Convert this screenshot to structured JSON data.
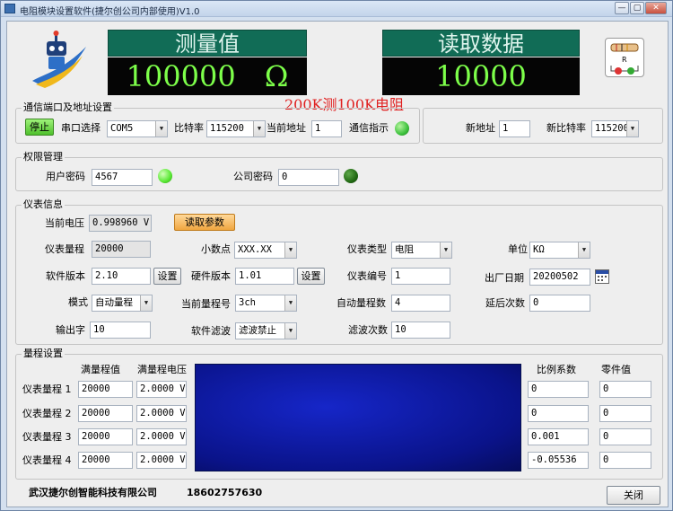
{
  "window": {
    "title": "电阻模块设置软件(捷尔创公司内部使用)V1.0",
    "controls": [
      "—",
      "▢",
      "✕"
    ]
  },
  "display": {
    "measured_title": "测量值",
    "measured_value": "100000",
    "measured_unit": "Ω",
    "read_title": "读取数据",
    "read_value": "10000",
    "annotation": "200K测100K电阻",
    "annotation_color": "#e02020",
    "screen_bg": "#050505",
    "digit_color": "#7dff4a"
  },
  "comm": {
    "group_title": "通信端口及地址设置",
    "stop_button": "停止",
    "port_label": "串口选择",
    "port_value": "COM5",
    "baud_label": "比特率",
    "baud_value": "115200",
    "addr_label": "当前地址",
    "addr_value": "1",
    "indicator_label": "通信指示",
    "indicator_color": "#3cc13c",
    "new_addr_label": "新地址",
    "new_addr_value": "1",
    "new_baud_label": "新比特率",
    "new_baud_value": "115200"
  },
  "auth": {
    "group_title": "权限管理",
    "user_pwd_label": "用户密码",
    "user_pwd_value": "4567",
    "user_led_color": "#57e832",
    "company_pwd_label": "公司密码",
    "company_pwd_value": "0",
    "company_led_color": "#226a14"
  },
  "instrument": {
    "group_title": "仪表信息",
    "voltage_label": "当前电压",
    "voltage_value": "0.998960 V",
    "read_params_button": "读取参数",
    "range_label": "仪表量程",
    "range_value": "20000",
    "decimal_label": "小数点",
    "decimal_value": "XXX.XX",
    "type_label": "仪表类型",
    "type_value": "电阻",
    "unit_label": "单位",
    "unit_value": "KΩ",
    "sw_ver_label": "软件版本",
    "sw_ver_value": "2.10",
    "set_button": "设置",
    "hw_ver_label": "硬件版本",
    "hw_ver_value": "1.01",
    "serial_label": "仪表编号",
    "serial_value": "1",
    "date_label": "出厂日期",
    "date_value": "20200502",
    "mode_label": "模式",
    "mode_value": "自动量程",
    "cur_range_label": "当前量程号",
    "cur_range_value": "3ch",
    "auto_count_label": "自动量程数",
    "auto_count_value": "4",
    "delay_label": "延后次数",
    "delay_value": "0",
    "output_label": "输出字",
    "output_value": "10",
    "filter_label": "软件滤波",
    "filter_value": "滤波禁止",
    "filter_count_label": "滤波次数",
    "filter_count_value": "10"
  },
  "ranges": {
    "group_title": "量程设置",
    "headers": {
      "full_value": "满量程值",
      "full_voltage": "满量程电压",
      "ratio": "比例系数",
      "zero": "零件值"
    },
    "rows": [
      {
        "label": "仪表量程 1",
        "full_value": "20000",
        "full_voltage": "2.0000 V",
        "ratio": "0",
        "zero": "0"
      },
      {
        "label": "仪表量程 2",
        "full_value": "20000",
        "full_voltage": "2.0000 V",
        "ratio": "0",
        "zero": "0"
      },
      {
        "label": "仪表量程 3",
        "full_value": "20000",
        "full_voltage": "2.0000 V",
        "ratio": "0.001",
        "zero": "0"
      },
      {
        "label": "仪表量程 4",
        "full_value": "20000",
        "full_voltage": "2.0000 V",
        "ratio": "-0.05536",
        "zero": "0"
      }
    ],
    "graph_color": "#0c1a9a"
  },
  "footer": {
    "company": "武汉捷尔创智能科技有限公司",
    "phone": "18602757630",
    "close_button": "关闭"
  }
}
